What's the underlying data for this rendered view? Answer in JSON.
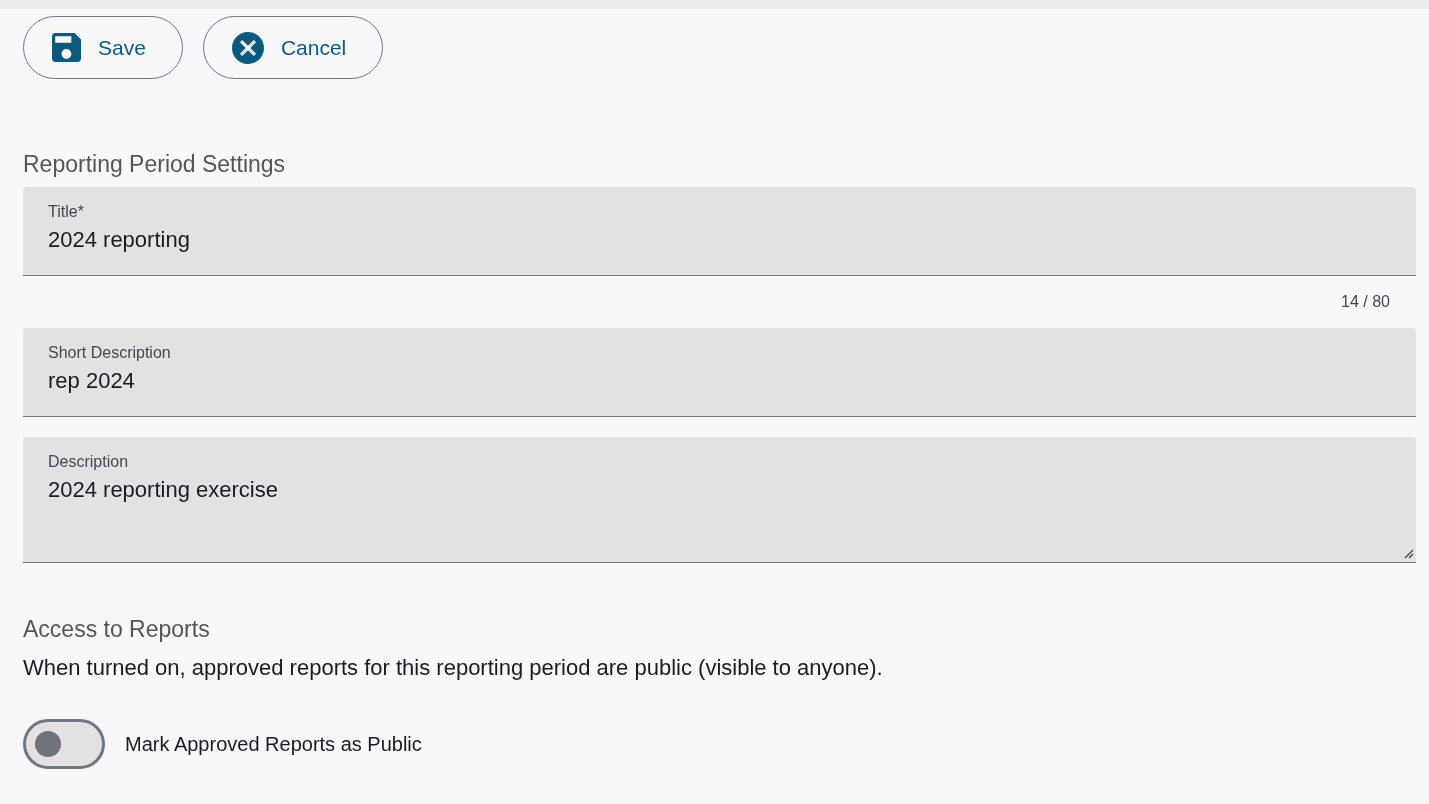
{
  "actions": [
    {
      "kind": "save",
      "label": "Save"
    },
    {
      "kind": "cancel",
      "label": "Cancel"
    }
  ],
  "settings": {
    "heading": "Reporting Period Settings",
    "fields": [
      {
        "kind": "input",
        "label": "Title*",
        "value": "2024 reporting",
        "counter": "14 / 80"
      },
      {
        "kind": "input",
        "label": "Short Description",
        "value": "rep 2024"
      },
      {
        "kind": "textarea",
        "label": "Description",
        "value": "2024 reporting exercise"
      }
    ]
  },
  "access": {
    "heading": "Access to Reports",
    "description": "When turned on, approved reports for this reporting period are public (visible to anyone).",
    "toggle": {
      "label": "Mark Approved Reports as Public",
      "on": false
    }
  }
}
